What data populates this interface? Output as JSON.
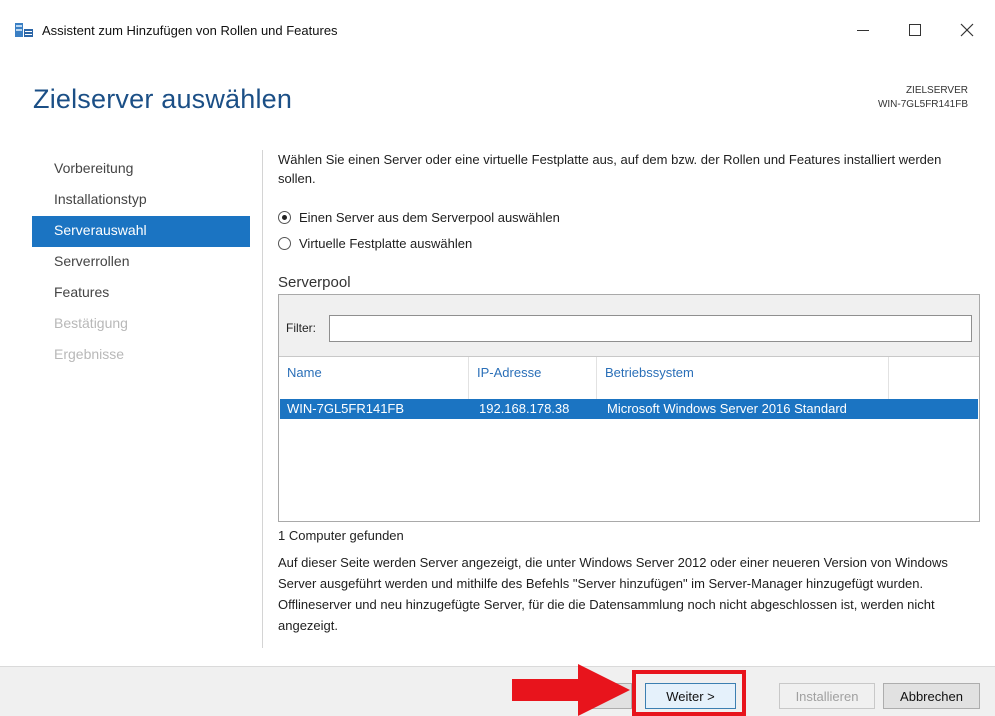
{
  "window": {
    "title": "Assistent zum Hinzufügen von Rollen und Features",
    "minimize_icon": "minimize-icon",
    "maximize_icon": "maximize-icon",
    "close_icon": "close-icon"
  },
  "header": {
    "page_title": "Zielserver auswählen",
    "destination_caption": "ZIELSERVER",
    "destination_server": "WIN-7GL5FR141FB"
  },
  "nav": {
    "items": [
      {
        "label": "Vorbereitung",
        "state": "normal"
      },
      {
        "label": "Installationstyp",
        "state": "normal"
      },
      {
        "label": "Serverauswahl",
        "state": "active"
      },
      {
        "label": "Serverrollen",
        "state": "normal"
      },
      {
        "label": "Features",
        "state": "normal"
      },
      {
        "label": "Bestätigung",
        "state": "disabled"
      },
      {
        "label": "Ergebnisse",
        "state": "disabled"
      }
    ]
  },
  "main": {
    "intro": "Wählen Sie einen Server oder eine virtuelle Festplatte aus, auf dem bzw. der Rollen und Features installiert werden sollen.",
    "options": [
      {
        "label": "Einen Server aus dem Serverpool auswählen",
        "checked": true
      },
      {
        "label": "Virtuelle Festplatte auswählen",
        "checked": false
      }
    ],
    "pool_label": "Serverpool",
    "filter_label": "Filter:",
    "filter_value": "",
    "columns": [
      "Name",
      "IP-Adresse",
      "Betriebssystem"
    ],
    "rows": [
      {
        "name": "WIN-7GL5FR141FB",
        "ip": "192.168.178.38",
        "os": "Microsoft Windows Server 2016 Standard",
        "selected": true
      }
    ],
    "found_count": "1 Computer gefunden",
    "description": "Auf dieser Seite werden Server angezeigt, die unter Windows Server 2012 oder einer neueren Version von Windows Server ausgeführt werden und mithilfe des Befehls \"Server hinzufügen\" im Server-Manager hinzugefügt wurden. Offlineserver und neu hinzugefügte Server, für die die Datensammlung noch nicht abgeschlossen ist, werden nicht angezeigt."
  },
  "footer": {
    "back_label": "",
    "next_label": "Weiter >",
    "install_label": "Installieren",
    "cancel_label": "Abbrechen"
  },
  "colors": {
    "accent": "#1b74c2",
    "title_blue": "#1b4f86",
    "annotation_red": "#e8141c"
  }
}
